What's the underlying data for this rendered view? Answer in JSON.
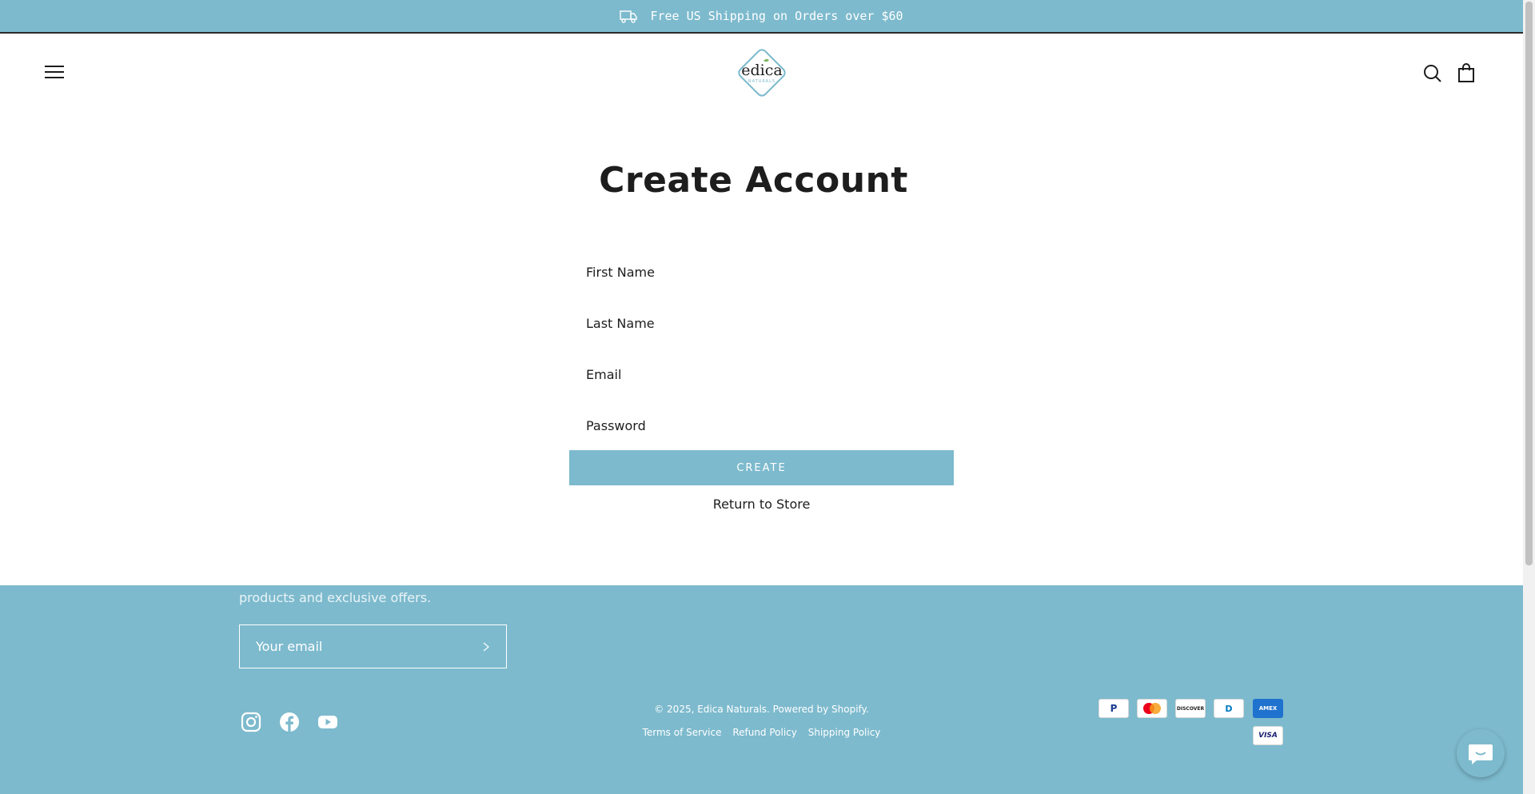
{
  "announcement": {
    "text": "Free US Shipping on Orders over $60",
    "icon": "truck-icon"
  },
  "header": {
    "menu_icon": "hamburger-menu-icon",
    "logo": {
      "brand": "edica",
      "sub": "NATURALS"
    },
    "search_icon": "search-icon",
    "cart_icon": "shopping-bag-icon"
  },
  "page": {
    "title": "Create Account",
    "fields": {
      "first_name": "First Name",
      "last_name": "Last Name",
      "email": "Email",
      "password": "Password"
    },
    "create_label": "CREATE",
    "return_label": "Return to Store"
  },
  "footer": {
    "newsletter_text": "products and exclusive offers.",
    "email_placeholder": "Your email",
    "socials": [
      "instagram-icon",
      "facebook-icon",
      "youtube-icon"
    ],
    "copyright": "© 2025, Edica Naturals. Powered by Shopify.",
    "policies": [
      "Terms of Service",
      "Refund Policy",
      "Shipping Policy"
    ],
    "payments": {
      "paypal": "P",
      "mastercard": "",
      "discover": "DISCOVER",
      "diners": "D",
      "amex": "AMEX",
      "visa": "VISA"
    }
  },
  "colors": {
    "accent": "#7dbacd",
    "text": "#1d1d1d",
    "background": "#ffffff"
  }
}
